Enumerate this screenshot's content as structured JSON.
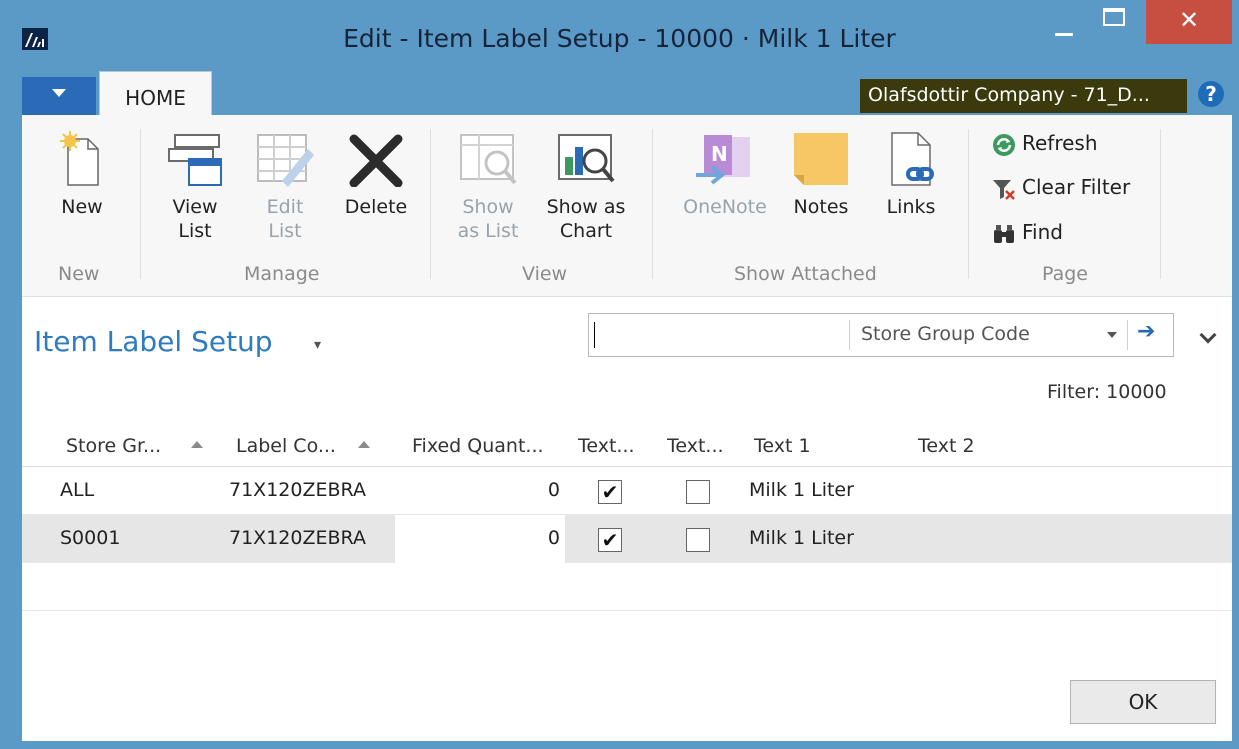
{
  "window": {
    "title": "Edit - Item Label Setup - 10000 · Milk 1 Liter",
    "close_glyph": "✕"
  },
  "ribbon_tabs": {
    "home": "HOME",
    "company": "Olafsdottir Company - 71_D...",
    "help_glyph": "?"
  },
  "ribbon": {
    "new": {
      "label": "New",
      "group": "New"
    },
    "manage": {
      "group": "Manage",
      "view_list": [
        "View",
        "List"
      ],
      "edit_list": [
        "Edit",
        "List"
      ],
      "delete": "Delete"
    },
    "view": {
      "group": "View",
      "show_as_list": [
        "Show",
        "as List"
      ],
      "show_as_chart": [
        "Show as",
        "Chart"
      ]
    },
    "show_attached": {
      "group": "Show Attached",
      "onenote": "OneNote",
      "notes": "Notes",
      "links": "Links"
    },
    "page": {
      "group": "Page",
      "refresh": "Refresh",
      "clear_filter": "Clear Filter",
      "find": "Find"
    }
  },
  "page": {
    "title": "Item Label Setup",
    "title_caret": "▾",
    "search": {
      "value": "",
      "field": "Store Group Code",
      "go_glyph": "➔"
    },
    "filter": "Filter: 10000"
  },
  "grid": {
    "columns": [
      "Store Gr...",
      "Label Co...",
      "Fixed Quant...",
      "Text...",
      "Text...",
      "Text 1",
      "Text 2"
    ],
    "rows": [
      {
        "store_group": "ALL",
        "label_code": "71X120ZEBRA",
        "fixed_qty": "0",
        "text_a": true,
        "text_b": false,
        "text1": "Milk 1 Liter",
        "text2": ""
      },
      {
        "store_group": "S0001",
        "label_code": "71X120ZEBRA",
        "fixed_qty": "0",
        "text_a": true,
        "text_b": false,
        "text1": "Milk 1 Liter",
        "text2": ""
      }
    ],
    "check_glyph": "✔"
  },
  "buttons": {
    "ok": "OK"
  },
  "colors": {
    "chrome": "#5b9ac7",
    "close": "#c74f42",
    "accent": "#2f7bc0",
    "company_bg": "#3a3a0c",
    "selected_row": "#e6e6e6"
  }
}
